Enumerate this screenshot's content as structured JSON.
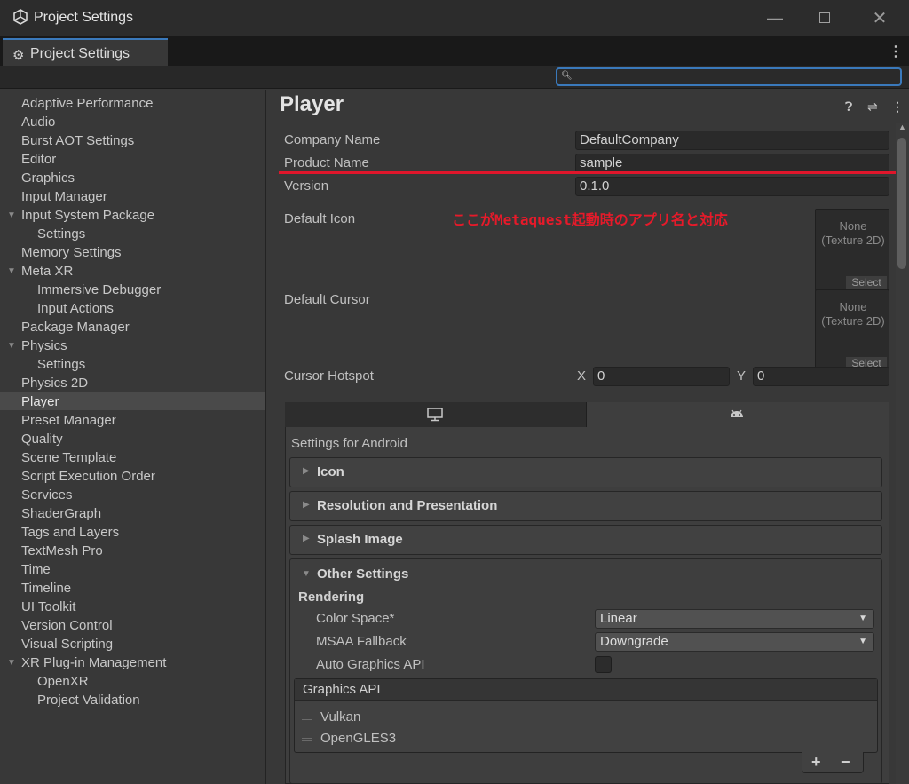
{
  "window": {
    "title": "Project Settings"
  },
  "tab": {
    "label": "Project Settings"
  },
  "search": {
    "placeholder": ""
  },
  "sidebar": {
    "items": [
      {
        "label": "Adaptive Performance"
      },
      {
        "label": "Audio"
      },
      {
        "label": "Burst AOT Settings"
      },
      {
        "label": "Editor"
      },
      {
        "label": "Graphics"
      },
      {
        "label": "Input Manager"
      },
      {
        "label": "Input System Package"
      },
      {
        "label": "Settings"
      },
      {
        "label": "Memory Settings"
      },
      {
        "label": "Meta XR"
      },
      {
        "label": "Immersive Debugger"
      },
      {
        "label": "Input Actions"
      },
      {
        "label": "Package Manager"
      },
      {
        "label": "Physics"
      },
      {
        "label": "Settings"
      },
      {
        "label": "Physics 2D"
      },
      {
        "label": "Player"
      },
      {
        "label": "Preset Manager"
      },
      {
        "label": "Quality"
      },
      {
        "label": "Scene Template"
      },
      {
        "label": "Script Execution Order"
      },
      {
        "label": "Services"
      },
      {
        "label": "ShaderGraph"
      },
      {
        "label": "Tags and Layers"
      },
      {
        "label": "TextMesh Pro"
      },
      {
        "label": "Time"
      },
      {
        "label": "Timeline"
      },
      {
        "label": "UI Toolkit"
      },
      {
        "label": "Version Control"
      },
      {
        "label": "Visual Scripting"
      },
      {
        "label": "XR Plug-in Management"
      },
      {
        "label": "OpenXR"
      },
      {
        "label": "Project Validation"
      }
    ],
    "selected": "Player"
  },
  "player": {
    "title": "Player",
    "company_label": "Company Name",
    "company_value": "DefaultCompany",
    "product_label": "Product Name",
    "product_value": "sample",
    "version_label": "Version",
    "version_value": "0.1.0",
    "default_icon_label": "Default Icon",
    "default_cursor_label": "Default Cursor",
    "texture_none": "None",
    "texture_type": "(Texture 2D)",
    "select_label": "Select",
    "cursor_hotspot_label": "Cursor Hotspot",
    "hotspot_x_label": "X",
    "hotspot_x": "0",
    "hotspot_y_label": "Y",
    "hotspot_y": "0",
    "annotation": "ここがMetaquest起動時のアプリ名と対応"
  },
  "platform": {
    "settings_for": "Settings for Android",
    "sections": [
      {
        "title": "Icon"
      },
      {
        "title": "Resolution and Presentation"
      },
      {
        "title": "Splash Image"
      },
      {
        "title": "Other Settings"
      }
    ],
    "rendering_label": "Rendering",
    "color_space_label": "Color Space*",
    "color_space_value": "Linear",
    "msaa_label": "MSAA Fallback",
    "msaa_value": "Downgrade",
    "auto_gapi_label": "Auto Graphics API",
    "auto_gapi_checked": false,
    "graphics_api_title": "Graphics API",
    "graphics_apis": [
      {
        "name": "Vulkan"
      },
      {
        "name": "OpenGLES3"
      }
    ],
    "plus": "+",
    "minus": "−"
  },
  "colors": {
    "accent": "#3a79bb",
    "annotation": "#e0162b",
    "selected": "#4a4a4a"
  }
}
